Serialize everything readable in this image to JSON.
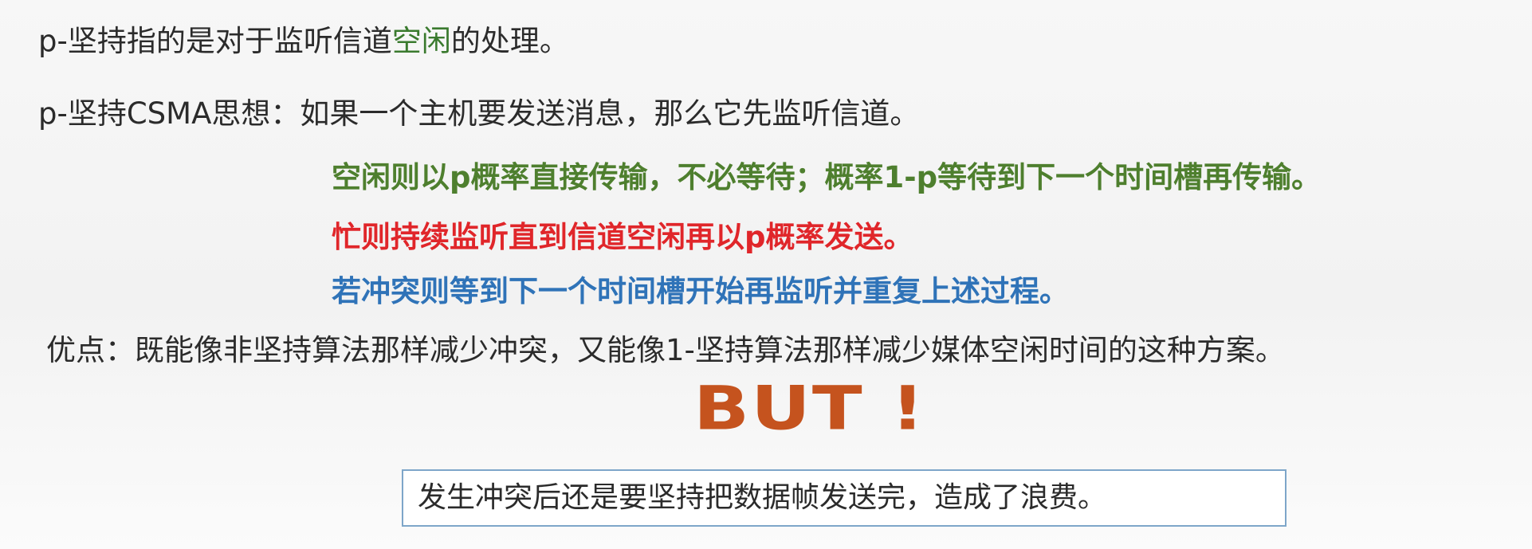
{
  "slide": {
    "line1": {
      "before": "p-坚持指的是对于监听信道",
      "highlight": "空闲",
      "after": "的处理。"
    },
    "line2": "p-坚持CSMA思想：如果一个主机要发送消息，那么它先监听信道。",
    "line3": "空闲则以p概率直接传输，不必等待；概率1-p等待到下一个时间槽再传输。",
    "line4": "忙则持续监听直到信道空闲再以p概率发送。",
    "line5": "若冲突则等到下一个时间槽开始再监听并重复上述过程。",
    "line6": "优点：既能像非坚持算法那样减少冲突，又能像1-坚持算法那样减少媒体空闲时间的这种方案。",
    "but": "BUT !",
    "box_text": "发生冲突后还是要坚持把数据帧发送完，造成了浪费。"
  },
  "colors": {
    "text": "#2b2b2b",
    "green": "#4e7f2e",
    "red": "#e0262a",
    "blue": "#2f73b8",
    "but": "#c5531e",
    "box_border": "#7ea6c9"
  }
}
